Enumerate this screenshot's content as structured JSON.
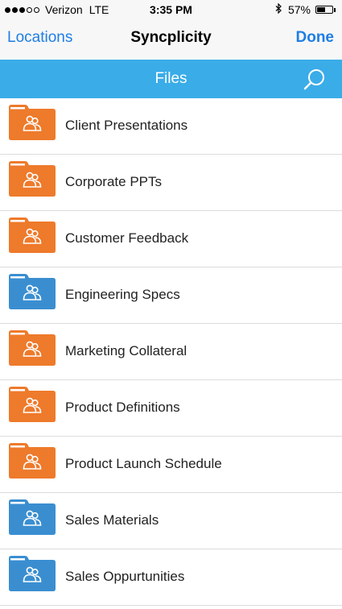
{
  "status_bar": {
    "carrier": "Verizon",
    "network": "LTE",
    "time": "3:35 PM",
    "battery_pct": "57%",
    "battery_level": 0.57,
    "signal_bars_filled": 3,
    "signal_bars_total": 5
  },
  "nav": {
    "back_label": "Locations",
    "title": "Syncplicity",
    "done_label": "Done"
  },
  "section": {
    "title": "Files",
    "search_icon": "search-icon"
  },
  "colors": {
    "accent": "#1e7ee4",
    "section_bar": "#3aace8",
    "folder_orange": "#ee7a2b",
    "folder_blue": "#3a8ed0"
  },
  "files": [
    {
      "name": "Client Presentations",
      "folder_color": "orange",
      "icon": "shared-folder-icon"
    },
    {
      "name": "Corporate PPTs",
      "folder_color": "orange",
      "icon": "shared-folder-icon"
    },
    {
      "name": "Customer Feedback",
      "folder_color": "orange",
      "icon": "shared-folder-icon"
    },
    {
      "name": "Engineering Specs",
      "folder_color": "blue",
      "icon": "shared-folder-icon"
    },
    {
      "name": "Marketing Collateral",
      "folder_color": "orange",
      "icon": "shared-folder-icon"
    },
    {
      "name": "Product Definitions",
      "folder_color": "orange",
      "icon": "shared-folder-icon"
    },
    {
      "name": "Product Launch Schedule",
      "folder_color": "orange",
      "icon": "shared-folder-icon"
    },
    {
      "name": "Sales Materials",
      "folder_color": "blue",
      "icon": "shared-folder-icon"
    },
    {
      "name": "Sales Oppurtunities",
      "folder_color": "blue",
      "icon": "shared-folder-icon"
    }
  ]
}
